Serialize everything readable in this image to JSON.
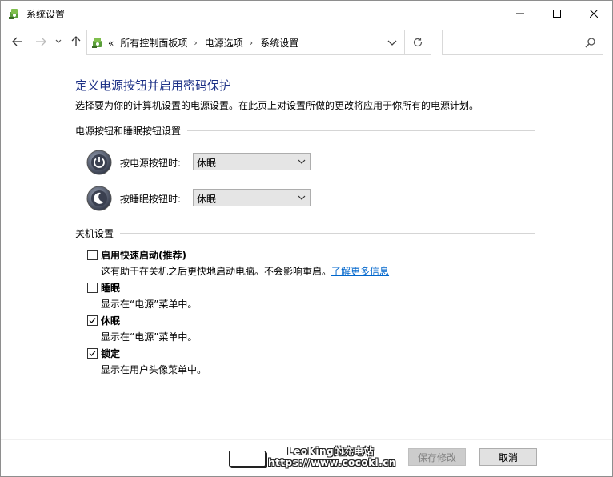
{
  "window": {
    "title": "系统设置"
  },
  "nav": {
    "back_icon": "arrow-left-icon",
    "forward_icon": "arrow-right-icon",
    "recent_icon": "chevron-down-icon",
    "up_icon": "arrow-up-icon",
    "breadcrumb_prefix": "«",
    "breadcrumbs": [
      "所有控制面板项",
      "电源选项",
      "系统设置"
    ],
    "search_placeholder": ""
  },
  "content": {
    "title": "定义电源按钮并启用密码保护",
    "description": "选择要为你的计算机设置的电源设置。在此页上对设置所做的更改将应用于你所有的电源计划。",
    "button_section": {
      "heading": "电源按钮和睡眠按钮设置",
      "power_button": {
        "label": "按电源按钮时:",
        "value": "休眠"
      },
      "sleep_button": {
        "label": "按睡眠按钮时:",
        "value": "休眠"
      }
    },
    "shutdown_section": {
      "heading": "关机设置",
      "options": [
        {
          "label": "启用快速启动(推荐)",
          "desc": "这有助于在关机之后更快地启动电脑。不会影响重启。",
          "link": "了解更多信息",
          "checked": false
        },
        {
          "label": "睡眠",
          "desc": "显示在“电源”菜单中。",
          "checked": false
        },
        {
          "label": "休眠",
          "desc": "显示在“电源”菜单中。",
          "checked": true
        },
        {
          "label": "锁定",
          "desc": "显示在用户头像菜单中。",
          "checked": true
        }
      ]
    }
  },
  "footer": {
    "save_label": "保存修改",
    "cancel_label": "取消"
  },
  "watermark": {
    "title": "LeoKing的充电站",
    "url": "https://www.cocokl.cn"
  },
  "colors": {
    "title_blue": "#1e3287",
    "link_blue": "#0066cc"
  }
}
